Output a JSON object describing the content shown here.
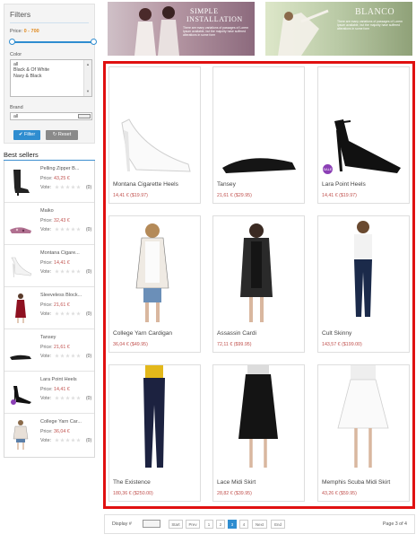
{
  "filters": {
    "title": "Filters",
    "price_label": "Price:",
    "price_range": "0 - 700",
    "color_label": "Color",
    "color_options": [
      "all",
      "Black & Of White",
      "Navy & Black"
    ],
    "brand_label": "Brand",
    "brand_value": "all",
    "filter_button": "Filter",
    "reset_button": "Reset"
  },
  "best_sellers": {
    "title": "Best sellers",
    "vote_label": "Vote:",
    "items": [
      {
        "name": "Pelling Zipper B...",
        "price_label": "Price:",
        "price": "43,25 €",
        "count": "(0)"
      },
      {
        "name": "Maiko",
        "price_label": "Price:",
        "price": "32,43 €",
        "count": "(0)"
      },
      {
        "name": "Montana Cigare...",
        "price_label": "Price:",
        "price": "14,41 €",
        "count": "(0)"
      },
      {
        "name": "Sleeveless Block...",
        "price_label": "Price:",
        "price": "21,61 €",
        "count": "(0)"
      },
      {
        "name": "Tansey",
        "price_label": "Price:",
        "price": "21,61 €",
        "count": "(0)"
      },
      {
        "name": "Lara Point Heels",
        "price_label": "Price:",
        "price": "14,41 €",
        "count": "(0)"
      },
      {
        "name": "College Yarn Car...",
        "price_label": "Price:",
        "price": "36,04 €",
        "count": "(0)"
      }
    ]
  },
  "banners": [
    {
      "title_line1": "SIMPLE",
      "title_line2": "INSTALLATION",
      "text": "There are many variations of passages of Lorem Ipsum available, but the majority have suffered alterations in some form"
    },
    {
      "title": "BLANCO",
      "text": "There are many variations of passages of Lorem Ipsum available, but the majority have suffered alterations in some form"
    }
  ],
  "products": [
    {
      "name": "Montana Cigarette Heels",
      "price": "14,41 € ($19.97)",
      "badge": ""
    },
    {
      "name": "Tansey",
      "price": "21,61 € ($29.95)",
      "badge": ""
    },
    {
      "name": "Lara Point Heels",
      "price": "14,41 € ($19.97)",
      "badge": "SALE"
    },
    {
      "name": "College Yarn Cardigan",
      "price": "36,04 € ($49.95)",
      "badge": ""
    },
    {
      "name": "Assassin Cardi",
      "price": "72,11 € ($99.95)",
      "badge": ""
    },
    {
      "name": "Cult Skinny",
      "price": "143,57 € ($199.00)",
      "badge": ""
    },
    {
      "name": "The Existence",
      "price": "180,36 € ($250.00)",
      "badge": ""
    },
    {
      "name": "Lace Midi Skirt",
      "price": "28,82 € ($39.95)",
      "badge": ""
    },
    {
      "name": "Memphis Scuba Midi Skirt",
      "price": "43,26 € ($59.95)",
      "badge": ""
    }
  ],
  "pagination": {
    "display_label": "Display #",
    "start": "Start",
    "prev": "Prev",
    "pages": [
      "1",
      "2",
      "3",
      "4"
    ],
    "current_page": "3",
    "next": "Next",
    "end": "End",
    "page_info": "Page 3 of 4"
  },
  "colors": {
    "accent": "#2f8dd0",
    "price": "#c0504d",
    "highlight_border": "#e01010",
    "sale_badge": "#8b3fb5"
  }
}
